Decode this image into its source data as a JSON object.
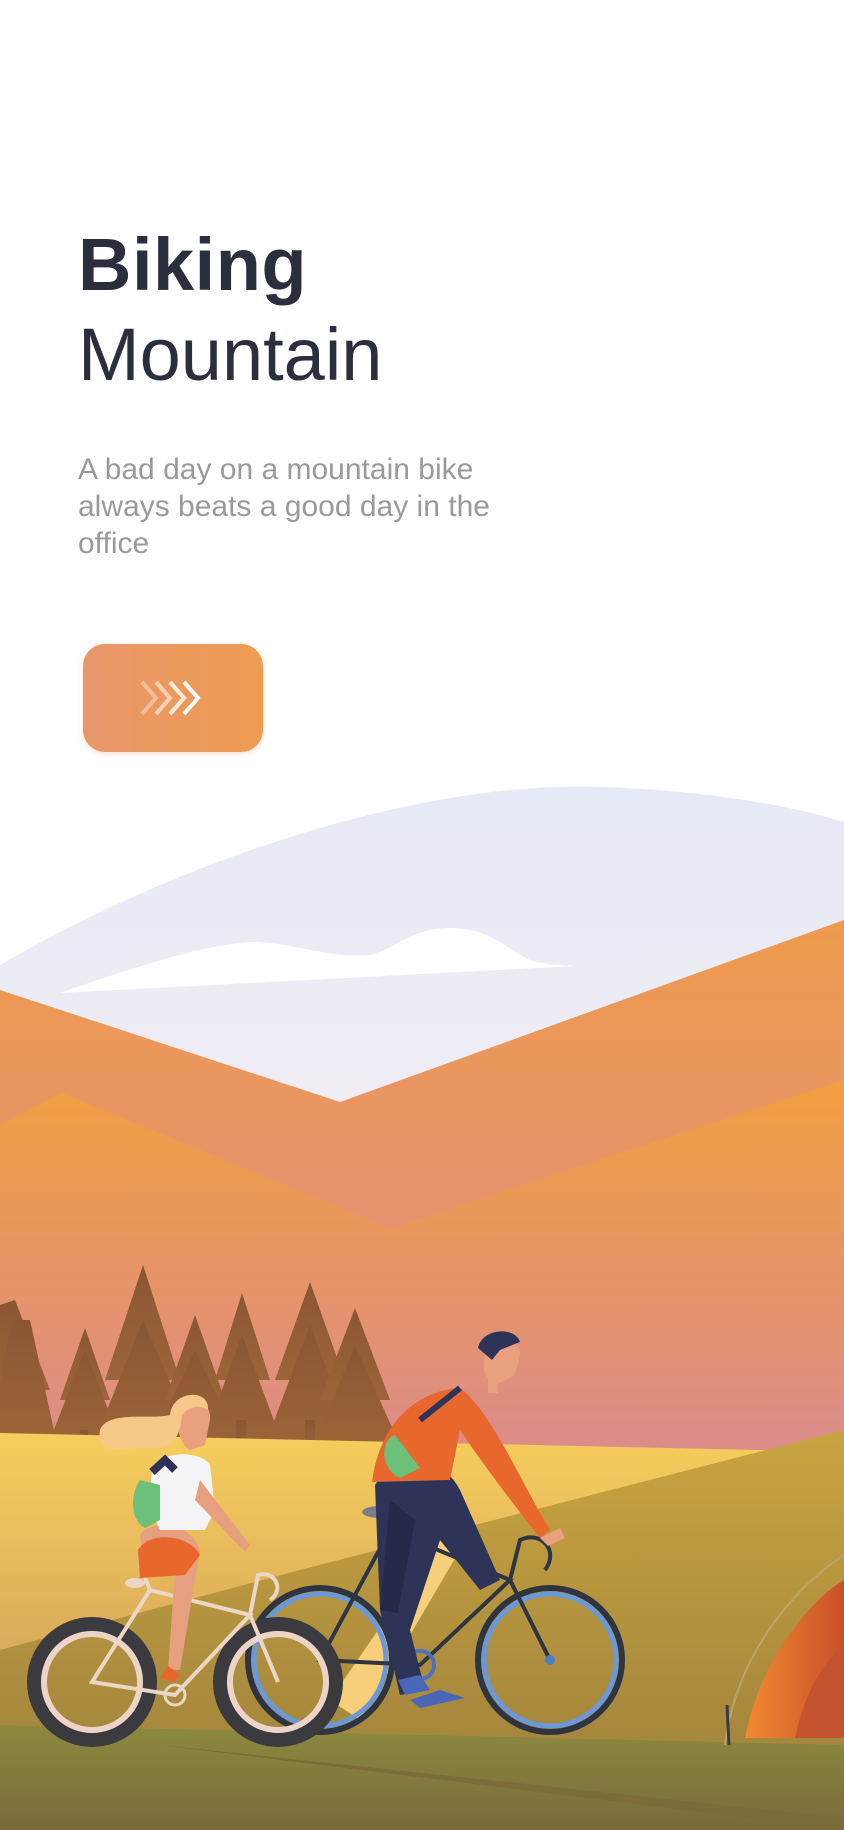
{
  "header": {
    "title_bold": "Biking",
    "title_regular": "Mountain"
  },
  "tagline": "A bad day on a mountain bike always beats a good day in the office",
  "next_button": {
    "icon": "triple-chevron-right-icon",
    "gradient": [
      "#e8976a",
      "#ef9b52"
    ]
  },
  "illustration": {
    "subject": "two cyclists riding through an autumn mountain landscape",
    "colors": {
      "sky": "#e8ecf8",
      "mountain": "#eb9a52",
      "pink_haze": "#dd8f8a",
      "trees": "#8d5a34",
      "meadow": "#f0c95e",
      "ground": "#8a7438",
      "tent": "#e8702e",
      "wheel_blue": "#6a98d8"
    }
  }
}
